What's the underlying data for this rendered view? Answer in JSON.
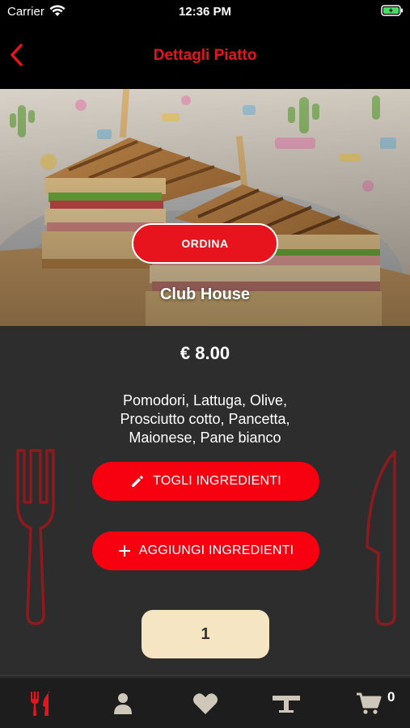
{
  "status_bar": {
    "carrier": "Carrier",
    "time": "12:36 PM"
  },
  "nav": {
    "title": "Dettagli Piatto",
    "back_icon": "chevron-left-icon"
  },
  "dish": {
    "order_label": "ORDINA",
    "name": "Club House",
    "price": "€ 8.00",
    "ingredients_lines": [
      "Pomodori, Lattuga, Olive,",
      "Prosciutto cotto, Pancetta,",
      "Maionese, Pane bianco"
    ],
    "remove_label": "TOGLI INGREDIENTI",
    "add_label": "AGGIUNGI INGREDIENTI",
    "quantity": "1"
  },
  "tab_bar": {
    "items": [
      {
        "icon": "fork-knife-icon",
        "active": true
      },
      {
        "icon": "user-icon",
        "active": false
      },
      {
        "icon": "heart-icon",
        "active": false
      },
      {
        "icon": "table-icon",
        "active": false
      },
      {
        "icon": "cart-icon",
        "active": false
      }
    ],
    "cart_count": "0"
  },
  "colors": {
    "accent": "#e8141d",
    "background": "#2d2d2d",
    "quantity_bg": "#f6e5c2",
    "bar_bg": "#000000"
  }
}
